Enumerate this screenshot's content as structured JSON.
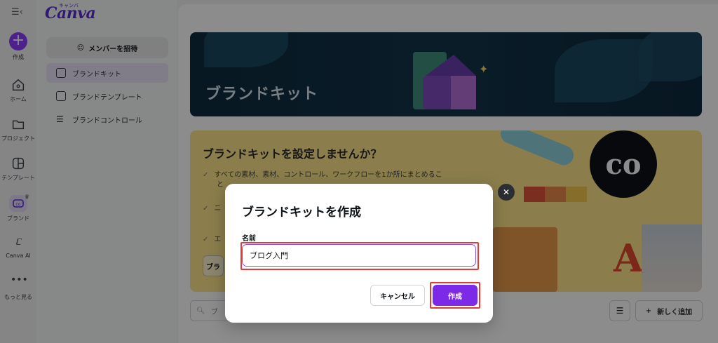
{
  "app": {
    "logo": "Canva",
    "logo_sub": "キャンバ"
  },
  "rail": {
    "items": [
      {
        "label": "作成",
        "icon": "plus-icon"
      },
      {
        "label": "ホーム",
        "icon": "home-icon"
      },
      {
        "label": "プロジェクト",
        "icon": "folder-icon"
      },
      {
        "label": "テンプレート",
        "icon": "template-icon"
      },
      {
        "label": "ブランド",
        "icon": "brand-icon"
      },
      {
        "label": "Canva AI",
        "icon": "canva-ai-icon"
      },
      {
        "label": "もっと見る",
        "icon": "more-icon"
      }
    ]
  },
  "sidebar": {
    "invite_label": "メンバーを招待",
    "items": [
      {
        "label": "ブランドキット",
        "icon": "brand-kit-icon",
        "active": true
      },
      {
        "label": "ブランドテンプレート",
        "icon": "brand-template-icon",
        "active": false
      },
      {
        "label": "ブランドコントロール",
        "icon": "sliders-icon",
        "active": false
      }
    ]
  },
  "main": {
    "hero_title": "ブランドキット",
    "promo": {
      "title": "ブランドキットを設定しませんか？",
      "lines": [
        "すべての素材、素材、コントロール、ワークフローを1か所にまとめるこ",
        "と",
        "ニ",
        "エ"
      ],
      "button_label": "ブラ",
      "badge": "co",
      "aa": "Aa"
    },
    "search_placeholder": "ブ",
    "add_label": "新しく追加",
    "colors": {
      "swatches": [
        "#e0543a",
        "#e8894a",
        "#f3c84b"
      ]
    }
  },
  "dialog": {
    "title": "ブランドキットを作成",
    "field_label": "名前",
    "field_value": "ブログ入門",
    "cancel_label": "キャンセル",
    "create_label": "作成",
    "close_icon": "close-icon"
  },
  "colors": {
    "accent": "#7d2ae8",
    "highlight": "#e53935"
  }
}
